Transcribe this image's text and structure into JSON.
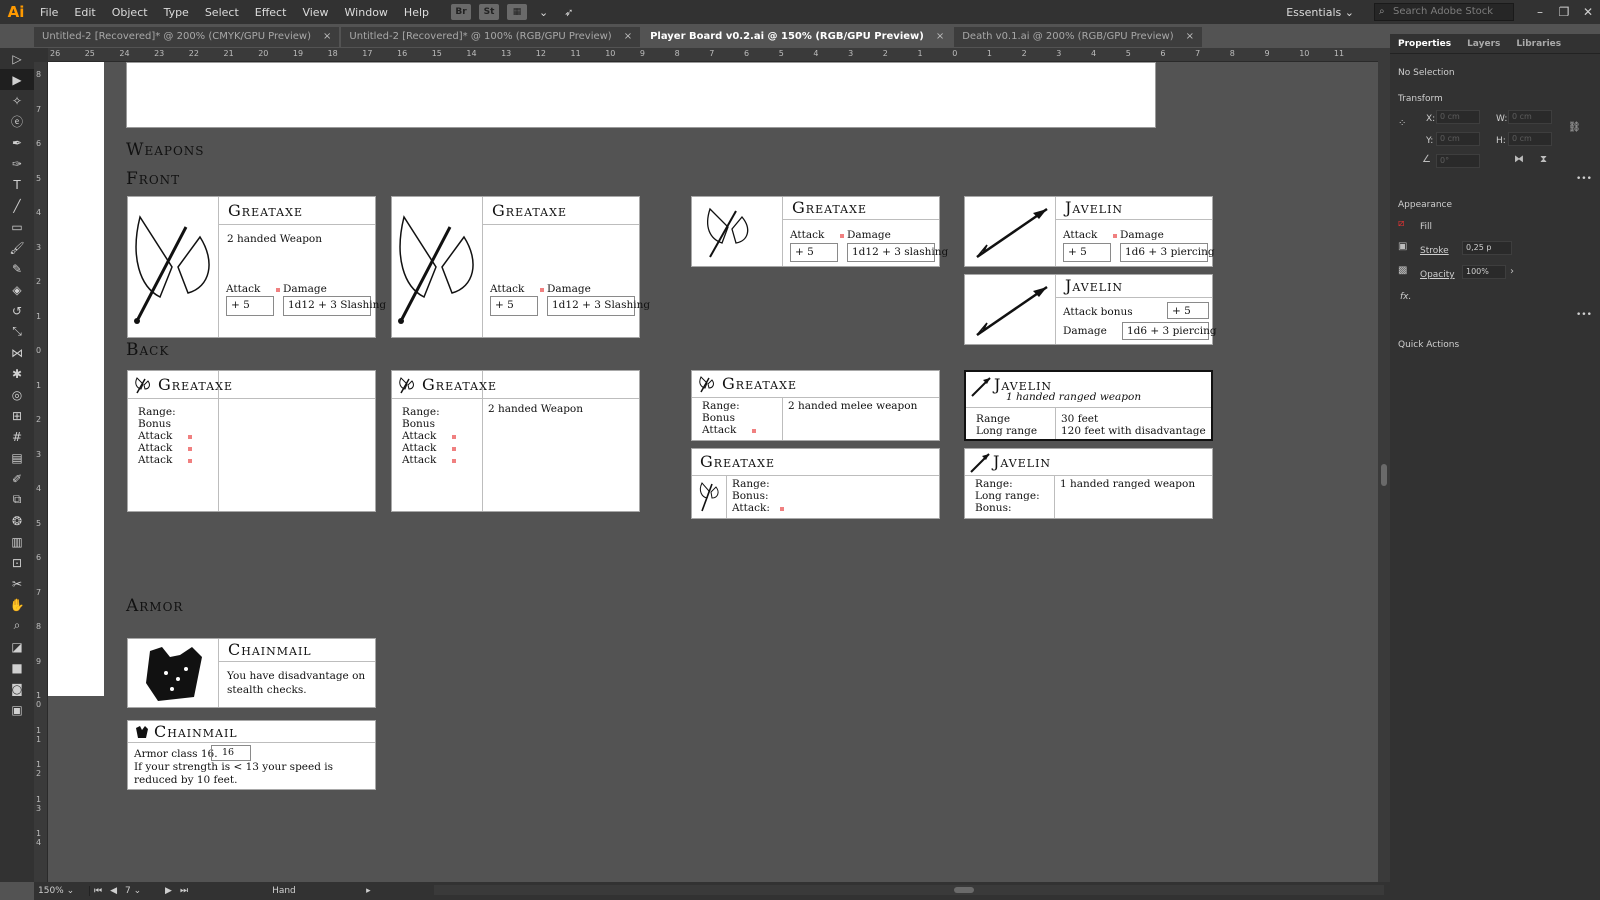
{
  "app": {
    "logo": "Ai"
  },
  "menu": [
    "File",
    "Edit",
    "Object",
    "Type",
    "Select",
    "Effect",
    "View",
    "Window",
    "Help"
  ],
  "app_buttons": [
    "Br",
    "St"
  ],
  "workspace": "Essentials",
  "search_placeholder": "Search Adobe Stock",
  "tabs": [
    {
      "label": "Untitled-2 [Recovered]* @ 200% (CMYK/GPU Preview)",
      "close": "×"
    },
    {
      "label": "Untitled-2 [Recovered]* @ 100% (RGB/GPU Preview)",
      "close": "×"
    },
    {
      "label": "Player Board v0.2.ai @ 150% (RGB/GPU Preview)",
      "close": "×"
    },
    {
      "label": "Death v0.1.ai @ 200% (RGB/GPU Preview)",
      "close": "×"
    }
  ],
  "ruler_h": [
    "26",
    "25",
    "24",
    "23",
    "22",
    "21",
    "20",
    "19",
    "18",
    "17",
    "16",
    "15",
    "14",
    "13",
    "12",
    "11",
    "10",
    "9",
    "8",
    "7",
    "6",
    "5",
    "4",
    "3",
    "2",
    "1",
    "0",
    "1",
    "2",
    "3",
    "4",
    "5",
    "6",
    "7",
    "8",
    "9",
    "10",
    "11"
  ],
  "ruler_v": [
    "8",
    "7",
    "6",
    "5",
    "4",
    "3",
    "2",
    "1",
    "0",
    "1",
    "2",
    "3",
    "4",
    "5",
    "6",
    "7",
    "8",
    "9",
    "1 0",
    "1 1",
    "1 2",
    "1 3",
    "1 4"
  ],
  "sections": {
    "weapons": "Weapons",
    "front": "Front",
    "back": "Back",
    "armor": "Armor"
  },
  "cards": {
    "f1": {
      "title": "Greataxe",
      "desc": "2 handed Weapon",
      "attack": "Attack",
      "damage": "Damage",
      "attack_val": "+ 5",
      "damage_val": "1d12 + 3 Slashing"
    },
    "f2": {
      "title": "Greataxe",
      "attack": "Attack",
      "damage": "Damage",
      "attack_val": "+ 5",
      "damage_val": "1d12 + 3 Slashing"
    },
    "f3": {
      "title": "Greataxe",
      "attack": "Attack",
      "damage": "Damage",
      "attack_val": "+ 5",
      "damage_val": "1d12 + 3 slashing"
    },
    "f4": {
      "title": "Javelin",
      "attack": "Attack",
      "damage": "Damage",
      "attack_val": "+ 5",
      "damage_val": "1d6 + 3 piercing"
    },
    "f5": {
      "title": "Javelin",
      "attack_bonus": "Attack bonus",
      "attack_val": "+ 5",
      "damage": "Damage",
      "damage_val": "1d6 + 3 piercing"
    },
    "b1": {
      "title": "Greataxe",
      "range": "Range:",
      "bonus": "Bonus",
      "attack": "Attack"
    },
    "b2": {
      "title": "Greataxe",
      "range": "Range:",
      "bonus": "Bonus",
      "attack": "Attack",
      "desc": "2 handed Weapon"
    },
    "b3": {
      "title": "Greataxe",
      "range": "Range:",
      "bonus": "Bonus",
      "attack": "Attack",
      "desc": "2 handed melee weapon"
    },
    "b4": {
      "title": "Javelin",
      "subtitle": "1 handed ranged weapon",
      "range": "Range",
      "long_range": "Long range",
      "range_val": "30 feet",
      "long_range_val": "120 feet with disadvantage"
    },
    "b5": {
      "title": "Greataxe",
      "range": "Range:",
      "bonus": "Bonus:",
      "attack": "Attack:"
    },
    "b6": {
      "title": "Javelin",
      "range": "Range:",
      "long_range": "Long range:",
      "bonus": "Bonus:",
      "desc": "1 handed ranged weapon"
    },
    "a1": {
      "title": "Chainmail",
      "desc": "You have disadvantage on stealth checks."
    },
    "a2": {
      "title": "Chainmail",
      "ac_label": "Armor class 16.",
      "ac_val": "16",
      "note": "If your strength is < 13 your speed is reduced by 10 feet."
    }
  },
  "status": {
    "zoom": "150%",
    "page": "7",
    "tool": "Hand"
  },
  "panel": {
    "tabs": [
      "Properties",
      "Layers",
      "Libraries"
    ],
    "selection": "No Selection",
    "transform": "Transform",
    "x_label": "X:",
    "y_label": "Y:",
    "w_label": "W:",
    "h_label": "H:",
    "x_val": "0 cm",
    "y_val": "0 cm",
    "w_val": "0 cm",
    "h_val": "0 cm",
    "angle_val": "0°",
    "appearance": "Appearance",
    "fill": "Fill",
    "stroke": "Stroke",
    "stroke_val": "0,25 p",
    "opacity": "Opacity",
    "opacity_val": "100%",
    "fx": "fx.",
    "quick_actions": "Quick Actions",
    "more": "•••"
  },
  "colors": {
    "accent": "#ff9a00",
    "ui_dark": "#323232",
    "canvas": "#535353",
    "marker": "#f08080"
  }
}
